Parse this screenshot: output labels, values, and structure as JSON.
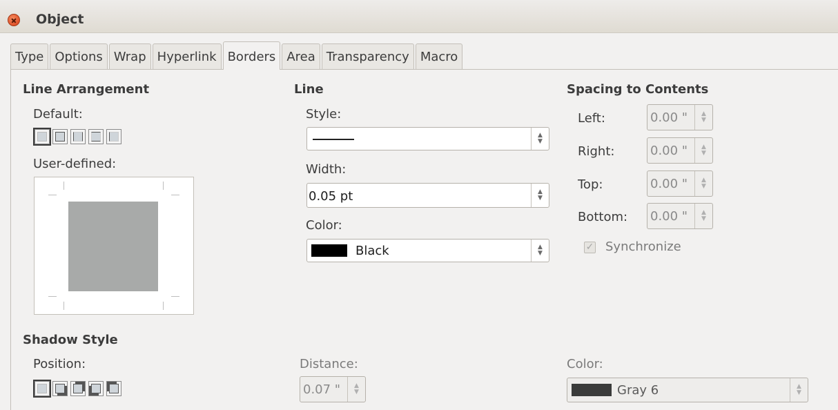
{
  "window": {
    "title": "Object"
  },
  "tabs": [
    "Type",
    "Options",
    "Wrap",
    "Hyperlink",
    "Borders",
    "Area",
    "Transparency",
    "Macro"
  ],
  "active_tab": "Borders",
  "line_arrangement": {
    "heading": "Line Arrangement",
    "default_label": "Default:",
    "user_defined_label": "User-defined:"
  },
  "line": {
    "heading": "Line",
    "style_label": "Style:",
    "width_label": "Width:",
    "width_value": "0.05 pt",
    "color_label": "Color:",
    "color_value": "Black",
    "color_hex": "#000000"
  },
  "spacing": {
    "heading": "Spacing to Contents",
    "left_label": "Left:",
    "left_value": "0.00 \"",
    "right_label": "Right:",
    "right_value": "0.00 \"",
    "top_label": "Top:",
    "top_value": "0.00 \"",
    "bottom_label": "Bottom:",
    "bottom_value": "0.00 \"",
    "synchronize_label": "Synchronize",
    "synchronize_checked": true
  },
  "shadow": {
    "heading": "Shadow Style",
    "position_label": "Position:",
    "distance_label": "Distance:",
    "distance_value": "0.07 \"",
    "color_label": "Color:",
    "color_value": "Gray 6",
    "color_hex": "#3a3b3a"
  },
  "colors": {
    "titlebar": "#e6e3de",
    "close": "#e0522a",
    "preview_fill": "#a8aaa9"
  }
}
